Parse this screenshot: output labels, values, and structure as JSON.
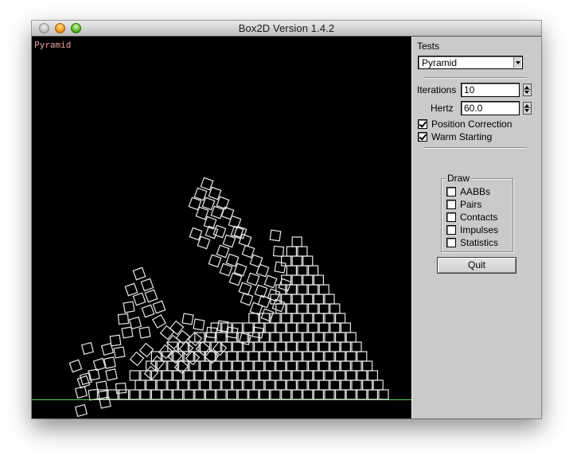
{
  "window": {
    "title": "Box2D Version 1.4.2",
    "buttons": [
      "close",
      "minimize",
      "zoom"
    ]
  },
  "canvas": {
    "test_label": "Pyramid",
    "colors": {
      "background": "#000000",
      "box_outline": "#e8e8e8",
      "ground": "#5fd35f",
      "label": "#f0a0a0"
    }
  },
  "panel": {
    "tests_label": "Tests",
    "tests_selected": "Pyramid",
    "iterations_label": "Iterations",
    "iterations_value": "10",
    "hertz_label": "Hertz",
    "hertz_value": "60.0",
    "position_correction": {
      "label": "Position Correction",
      "checked": true
    },
    "warm_starting": {
      "label": "Warm Starting",
      "checked": true
    },
    "draw_group": {
      "legend": "Draw",
      "options": [
        {
          "label": "AABBs",
          "checked": false
        },
        {
          "label": "Pairs",
          "checked": false
        },
        {
          "label": "Contacts",
          "checked": false
        },
        {
          "label": "Impulses",
          "checked": false
        },
        {
          "label": "Statistics",
          "checked": false
        }
      ]
    },
    "quit_label": "Quit"
  }
}
